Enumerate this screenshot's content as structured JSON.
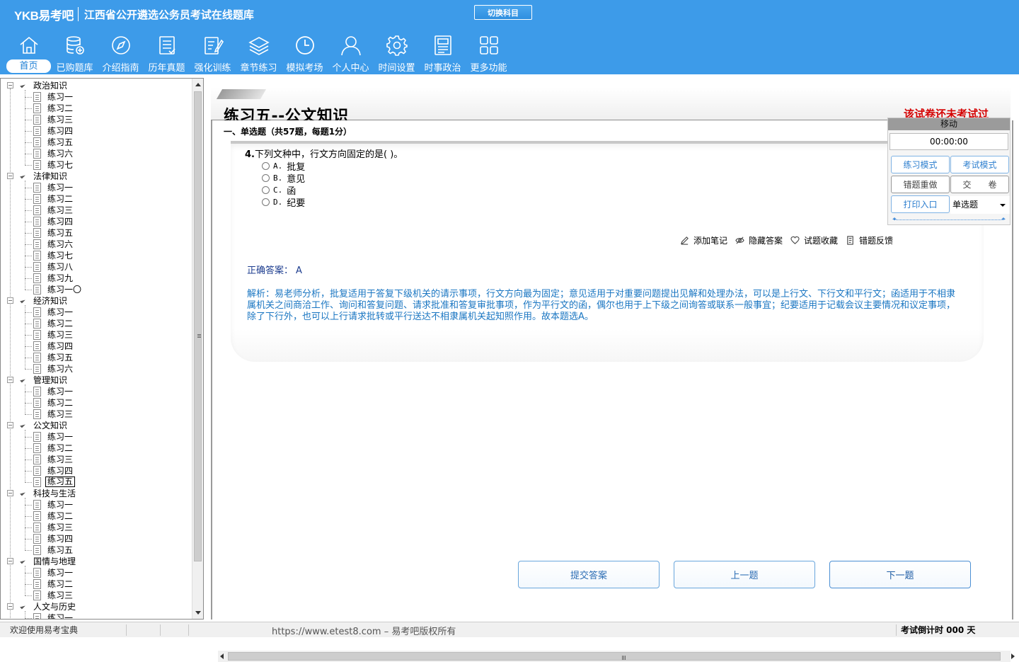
{
  "header": {
    "logo": "YKB易考吧",
    "title": "江西省公开遴选公务员考试在线题库",
    "switch_subject": "切换科目"
  },
  "nav": [
    {
      "label": "首页",
      "icon": "home-icon"
    },
    {
      "label": "已购题库",
      "icon": "database-icon"
    },
    {
      "label": "介绍指南",
      "icon": "compass-icon"
    },
    {
      "label": "历年真题",
      "icon": "list-doc-icon"
    },
    {
      "label": "强化训练",
      "icon": "edit-doc-icon"
    },
    {
      "label": "章节练习",
      "icon": "layers-icon"
    },
    {
      "label": "模拟考场",
      "icon": "clock-icon"
    },
    {
      "label": "个人中心",
      "icon": "user-icon"
    },
    {
      "label": "时间设置",
      "icon": "gear-icon"
    },
    {
      "label": "时事政治",
      "icon": "news-icon"
    },
    {
      "label": "更多功能",
      "icon": "grid-icon"
    }
  ],
  "tree": [
    {
      "label": "政治知识",
      "items": [
        "练习一",
        "练习二",
        "练习三",
        "练习四",
        "练习五",
        "练习六",
        "练习七"
      ]
    },
    {
      "label": "法律知识",
      "items": [
        "练习一",
        "练习二",
        "练习三",
        "练习四",
        "练习五",
        "练习六",
        "练习七",
        "练习八",
        "练习九",
        "练习一〇"
      ]
    },
    {
      "label": "经济知识",
      "items": [
        "练习一",
        "练习二",
        "练习三",
        "练习四",
        "练习五",
        "练习六"
      ]
    },
    {
      "label": "管理知识",
      "items": [
        "练习一",
        "练习二",
        "练习三"
      ]
    },
    {
      "label": "公文知识",
      "items": [
        "练习一",
        "练习二",
        "练习三",
        "练习四",
        "练习五"
      ],
      "selected": 4
    },
    {
      "label": "科技与生活",
      "items": [
        "练习一",
        "练习二",
        "练习三",
        "练习四",
        "练习五"
      ]
    },
    {
      "label": "国情与地理",
      "items": [
        "练习一",
        "练习二",
        "练习三"
      ]
    },
    {
      "label": "人文与历史",
      "items": [
        "练习一"
      ]
    }
  ],
  "main": {
    "page_title": "练习五--公文知识",
    "status": "该试卷还未考试过",
    "section": "一、单选题（共57题，每题1分）",
    "question": {
      "number": "4.",
      "text": "下列文种中，行文方向固定的是( )。",
      "options": [
        {
          "letter": "A.",
          "text": "批复"
        },
        {
          "letter": "B.",
          "text": "意见"
        },
        {
          "letter": "C.",
          "text": "函"
        },
        {
          "letter": "D.",
          "text": "纪要"
        }
      ]
    },
    "tools": {
      "add_note": "添加笔记",
      "hide_answer": "隐藏答案",
      "favorite": "试题收藏",
      "report_error": "错题反馈"
    },
    "answer_label": "正确答案：",
    "answer_value": "A",
    "analysis": "解析：易老师分析，批复适用于答复下级机关的请示事项，行文方向最为固定；意见适用于对重要问题提出见解和处理办法，可以是上行文、下行文和平行文；函适用于不相隶属机关之间商洽工作、询问和答复问题、请求批准和答复审批事项，作为平行文的函，偶尔也用于上下级之间询答或联系一般事宜；纪要适用于记载会议主要情况和议定事项，除了下行外，也可以上行请求批转或平行送达不相隶属机关起知照作用。故本题选A。",
    "buttons": {
      "submit": "提交答案",
      "prev": "上一题",
      "next": "下一题"
    }
  },
  "control": {
    "move": "移动",
    "timer": "00:00:00",
    "practice_mode": "练习模式",
    "exam_mode": "考试模式",
    "redo_wrong": "错题重做",
    "hand_in": "交　　卷",
    "print": "打印入口",
    "question_type": "单选题"
  },
  "statusbar": {
    "welcome": "欢迎使用易考宝典",
    "copyright": "https://www.etest8.com – 易考吧版权所有",
    "countdown": "考试倒计时 000 天"
  },
  "colors": {
    "header_bg": "#3d9be9",
    "status_red": "#d40000",
    "analysis_blue": "#1a76c2",
    "answer_navy": "#1d3d8f"
  }
}
